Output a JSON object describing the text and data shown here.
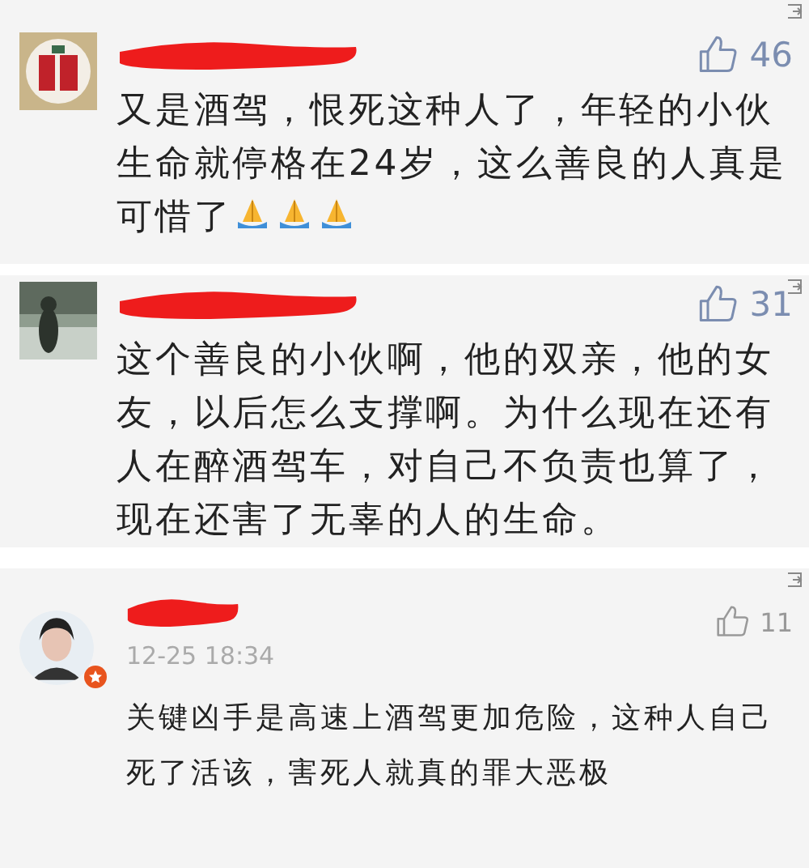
{
  "comments": [
    {
      "kind": "large",
      "badge": false,
      "likes": "46",
      "text": "又是酒驾，恨死这种人了，年轻的小伙生命就停格在24岁，这么善良的人真是可惜了",
      "emoji": [
        {
          "kind": "pray"
        },
        {
          "kind": "pray"
        },
        {
          "kind": "pray"
        }
      ]
    },
    {
      "kind": "large",
      "badge": false,
      "likes": "31",
      "text": "这个善良的小伙啊，他的双亲，他的女友，以后怎么支撑啊。为什么现在还有人在醉酒驾车，对自己不负责也算了，现在还害了无辜的人的生命。"
    },
    {
      "kind": "small",
      "avatar": {
        "kind": "person"
      },
      "badge": true,
      "likes": "11",
      "time": "12-25 18:34",
      "text": "关键凶手是高速上酒驾更加危险，这种人自己死了活该，害死人就真的罪大恶极"
    }
  ]
}
